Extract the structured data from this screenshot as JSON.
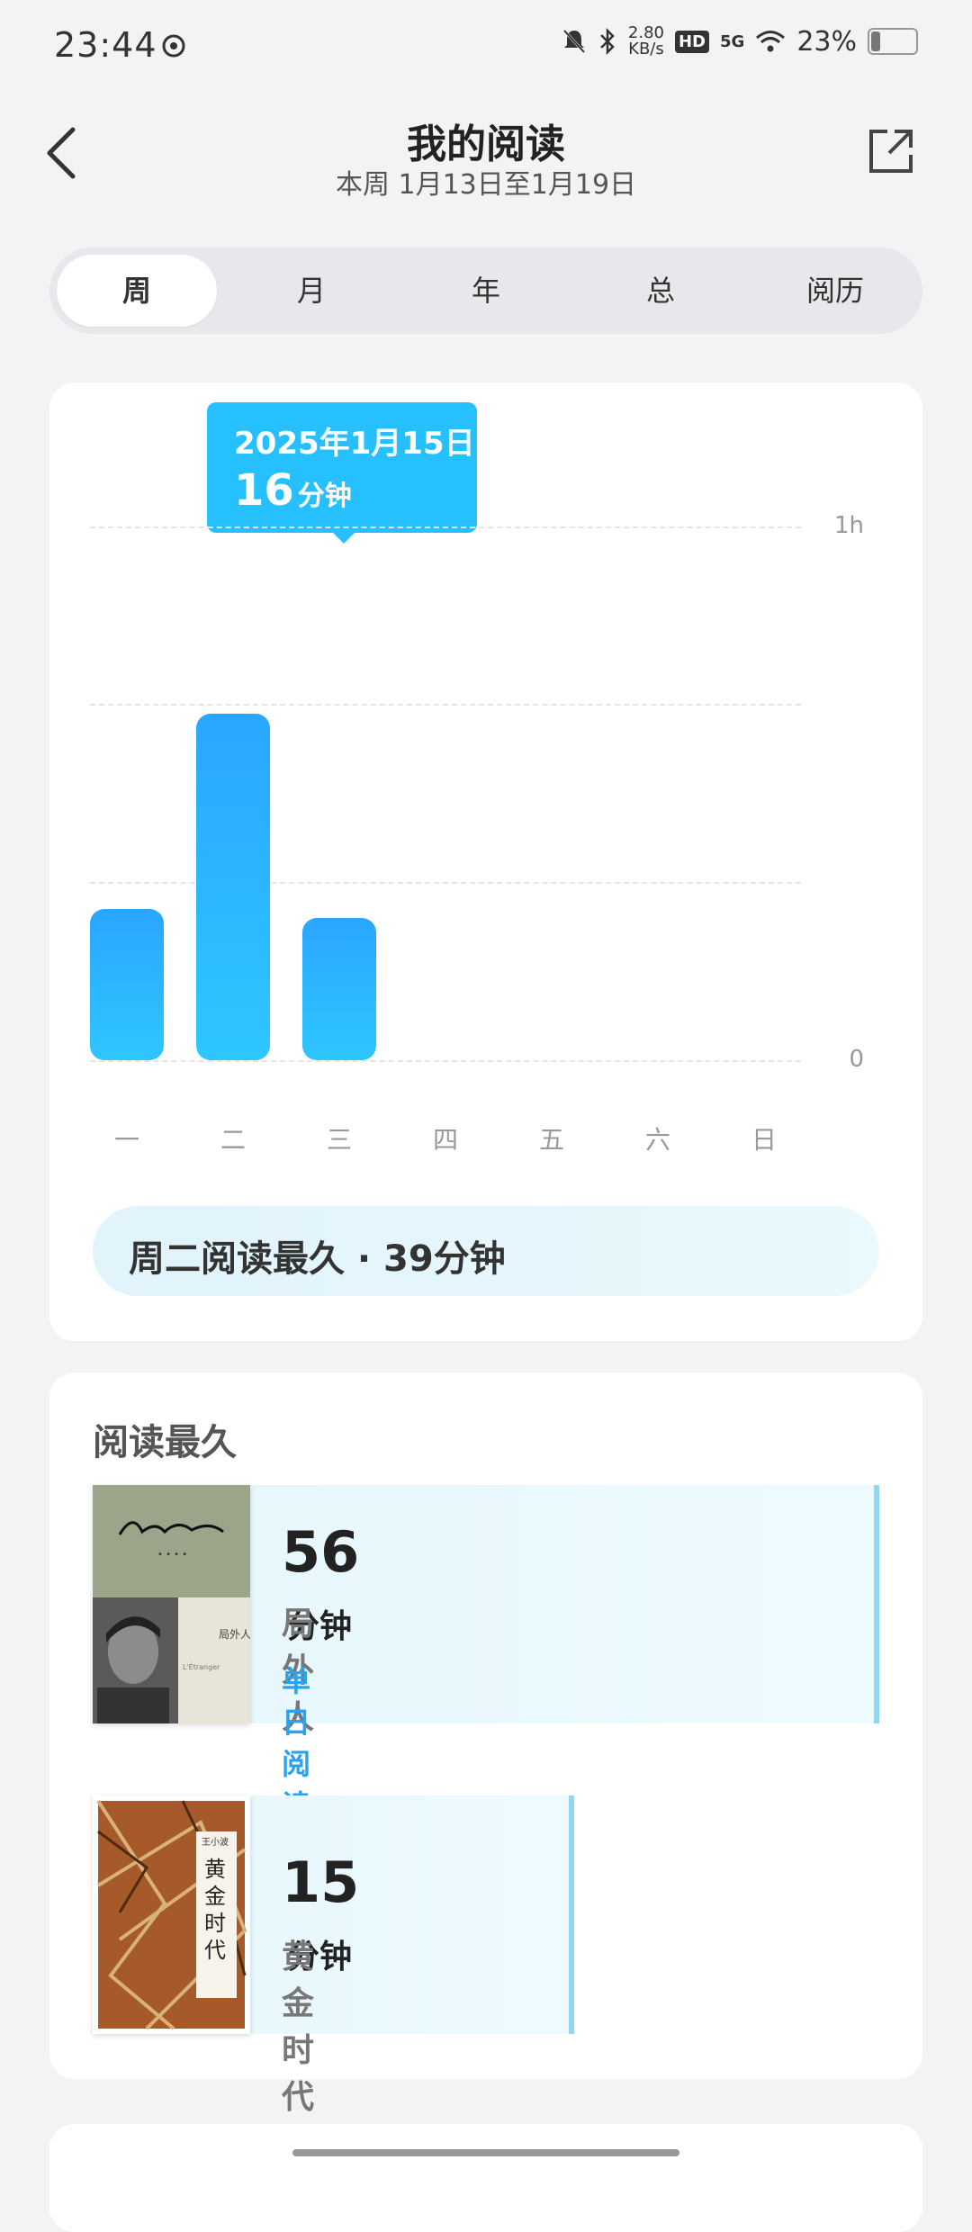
{
  "status": {
    "time": "23:44",
    "net_speed": "2.80\nKB/s",
    "hd": "HD",
    "network": "5G",
    "battery_pct": "23%",
    "battery_level": 0.23
  },
  "header": {
    "title": "我的阅读",
    "subtitle": "本周 1月13日至1月19日"
  },
  "tabs": [
    {
      "label": "周",
      "active": true
    },
    {
      "label": "月"
    },
    {
      "label": "年"
    },
    {
      "label": "总"
    },
    {
      "label": "阅历"
    }
  ],
  "chart_data": {
    "type": "bar",
    "categories": [
      "一",
      "二",
      "三",
      "四",
      "五",
      "六",
      "日"
    ],
    "values": [
      17,
      39,
      16,
      0,
      0,
      0,
      0
    ],
    "unit": "分钟",
    "y_ticks": [
      "0",
      "1h"
    ],
    "ylim": [
      0,
      60
    ],
    "grid": true,
    "tooltip": {
      "date": "2025年1月15日",
      "value": "16",
      "unit": "分钟"
    }
  },
  "summary": "周二阅读最久 · 39分钟",
  "longest": {
    "title": "阅读最久",
    "books": [
      {
        "minutes": "56",
        "unit": "分钟",
        "name": "局外人",
        "badge": "单日阅读最久",
        "share": 1.0
      },
      {
        "minutes": "15",
        "unit": "分钟",
        "name": "黄金时代",
        "badge": "",
        "share": 0.27
      }
    ]
  }
}
